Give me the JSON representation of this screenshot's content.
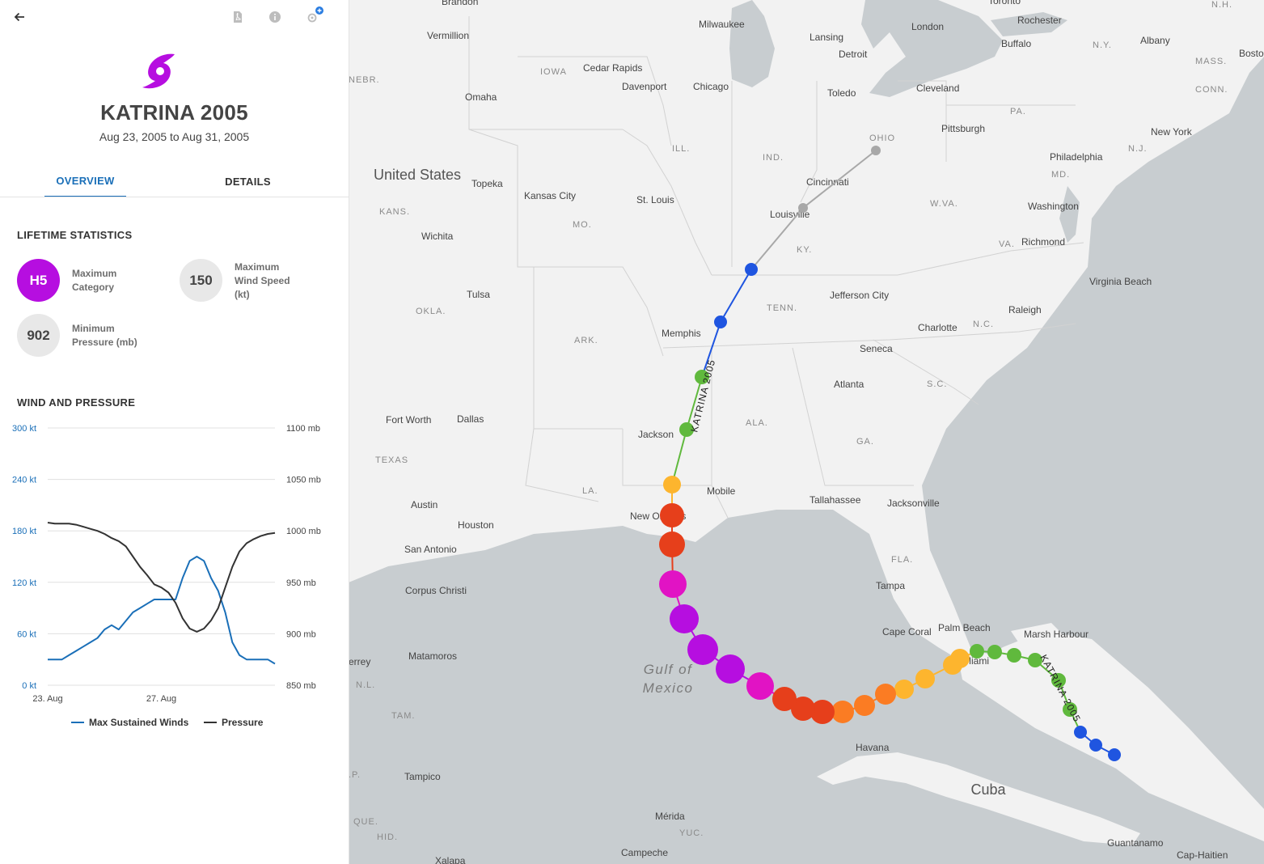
{
  "toolbar": {
    "back_icon": "arrow-left-icon",
    "pdf_icon": "pdf-icon",
    "info_icon": "info-icon",
    "locate_icon": "locate-add-icon"
  },
  "storm": {
    "icon": "hurricane-icon",
    "icon_color": "#b60ee0",
    "title": "KATRINA 2005",
    "dates": "Aug 23, 2005 to Aug 31, 2005"
  },
  "tabs": [
    {
      "label": "OVERVIEW",
      "active": true
    },
    {
      "label": "DETAILS",
      "active": false
    }
  ],
  "lifetime": {
    "heading": "LIFETIME STATISTICS",
    "category_value": "H5",
    "category_color": "#b60ee0",
    "category_label_1": "Maximum",
    "category_label_2": "Category",
    "wind_value": "150",
    "wind_label_1": "Maximum",
    "wind_label_2": "Wind Speed",
    "wind_label_3": "(kt)",
    "pressure_value": "902",
    "pressure_label_1": "Minimum",
    "pressure_label_2": "Pressure (mb)"
  },
  "wind_pressure": {
    "heading": "WIND AND PRESSURE",
    "legend_wind": "Max Sustained Winds",
    "legend_pressure": "Pressure"
  },
  "chart_data": {
    "type": "line",
    "title": "WIND AND PRESSURE",
    "x_tick_labels": [
      "23. Aug",
      "27. Aug"
    ],
    "y_left_ticks": [
      "300 kt",
      "240 kt",
      "180 kt",
      "120 kt",
      "60 kt",
      "0 kt"
    ],
    "y_right_ticks": [
      "1100 mb",
      "1050 mb",
      "1000 mb",
      "950 mb",
      "900 mb",
      "850 mb"
    ],
    "ylim_left": [
      0,
      300
    ],
    "ylim_right": [
      850,
      1100
    ],
    "x_days": [
      23,
      23.25,
      23.5,
      23.75,
      24,
      24.25,
      24.5,
      24.75,
      25,
      25.25,
      25.5,
      25.75,
      26,
      26.25,
      26.5,
      26.75,
      27,
      27.25,
      27.5,
      27.75,
      28,
      28.25,
      28.5,
      28.75,
      29,
      29.25,
      29.5,
      29.75,
      30,
      30.25,
      30.5,
      30.75,
      31
    ],
    "grid": true,
    "legend_position": "bottom",
    "series": [
      {
        "name": "Max Sustained Winds",
        "axis": "left",
        "color": "#1a6fb8",
        "values": [
          30,
          30,
          30,
          35,
          40,
          45,
          50,
          55,
          65,
          70,
          65,
          75,
          85,
          90,
          95,
          100,
          100,
          100,
          100,
          125,
          145,
          150,
          145,
          125,
          110,
          85,
          50,
          35,
          30,
          30,
          30,
          30,
          25
        ]
      },
      {
        "name": "Pressure",
        "axis": "right",
        "color": "#333333",
        "values": [
          1008,
          1007,
          1007,
          1007,
          1006,
          1004,
          1002,
          1000,
          997,
          993,
          990,
          985,
          975,
          965,
          957,
          948,
          945,
          940,
          930,
          915,
          905,
          902,
          905,
          913,
          925,
          945,
          965,
          980,
          988,
          992,
          995,
          997,
          998
        ]
      }
    ]
  },
  "map": {
    "track_label": "KATRINA 2005",
    "colors": {
      "depression": "#1f55e0",
      "storm": "#60b93d",
      "h1": "#fdb52e",
      "h2": "#fb7c23",
      "h3": "#e63f1b",
      "h4": "#e113c4",
      "h5": "#b60ee0",
      "extratropical": "#a8a8a8",
      "water": "#c8cdd0",
      "land": "#f2f2f2"
    },
    "labels": {
      "country_us": "United States",
      "gulf_1": "Gulf of",
      "gulf_2": "Mexico",
      "cuba": "Cuba",
      "state_iowa": "IOWA",
      "state_nebr": "NEBR.",
      "state_ill": "ILL.",
      "state_ind": "IND.",
      "state_ohio": "OHIO",
      "state_pa": "PA.",
      "state_ny": "N.Y.",
      "state_mass": "MASS.",
      "state_conn": "CONN.",
      "state_nj": "N.J.",
      "state_md": "MD.",
      "state_wva": "W.VA.",
      "state_va": "VA.",
      "state_kans": "KANS.",
      "state_mo": "MO.",
      "state_ky": "KY.",
      "state_tenn": "TENN.",
      "state_nc": "N.C.",
      "state_sc": "S.C.",
      "state_okla": "OKLA.",
      "state_ark": "ARK.",
      "state_ala": "ALA.",
      "state_ga": "GA.",
      "state_texas": "TEXAS",
      "state_la": "LA.",
      "state_fla": "FLA.",
      "state_nh": "N.H.",
      "mx_nl": "N.L.",
      "mx_tam": "TAM.",
      "mx_que": "QUE.",
      "mx_hid": "HID.",
      "mx_yuc": "YUC.",
      "mx_p": ".P.",
      "city_brandon": "Brandon",
      "city_toronto": "Toronto",
      "city_vermillion": "Vermillion",
      "city_milwaukee": "Milwaukee",
      "city_lansing": "Lansing",
      "city_london": "London",
      "city_rochester": "Rochester",
      "city_albany": "Albany",
      "city_boston": "Bosto",
      "city_cedar_rapids": "Cedar Rapids",
      "city_detroit": "Detroit",
      "city_buffalo": "Buffalo",
      "city_davenport": "Davenport",
      "city_chicago": "Chicago",
      "city_omaha": "Omaha",
      "city_toledo": "Toledo",
      "city_cleveland": "Cleveland",
      "city_pittsburgh": "Pittsburgh",
      "city_new_york": "New York",
      "city_philadelphia": "Philadelphia",
      "city_cincinnati": "Cincinnati",
      "city_topeka": "Topeka",
      "city_kansas_city": "Kansas City",
      "city_st_louis": "St. Louis",
      "city_washington": "Washington",
      "city_louisville": "Louisville",
      "city_wichita": "Wichita",
      "city_richmond": "Richmond",
      "city_virginia_beach": "Virginia Beach",
      "city_tulsa": "Tulsa",
      "city_jefferson_city": "Jefferson City",
      "city_raleigh": "Raleigh",
      "city_memphis": "Memphis",
      "city_charlotte": "Charlotte",
      "city_seneca": "Seneca",
      "city_atlanta": "Atlanta",
      "city_fort_worth": "Fort Worth",
      "city_dallas": "Dallas",
      "city_jackson": "Jackson",
      "city_mobile": "Mobile",
      "city_tallahassee": "Tallahassee",
      "city_jacksonville": "Jacksonville",
      "city_austin": "Austin",
      "city_new_orleans": "New Orleans",
      "city_houston": "Houston",
      "city_san_antonio": "San Antonio",
      "city_tampa": "Tampa",
      "city_corpus_christi": "Corpus Christi",
      "city_cape_coral": "Cape Coral",
      "city_palm_beach": "Palm Beach",
      "city_marsh_harbour": "Marsh Harbour",
      "city_miami": "Miami",
      "city_matamoros": "Matamoros",
      "city_monterrey": "errey",
      "city_havana": "Havana",
      "city_tampico": "Tampico",
      "city_merida": "Mérida",
      "city_campeche": "Campeche",
      "city_guantanamo": "Guantanamo",
      "city_cap_haitien": "Cap-Haitien",
      "city_jalapa": "Xalapa"
    }
  }
}
